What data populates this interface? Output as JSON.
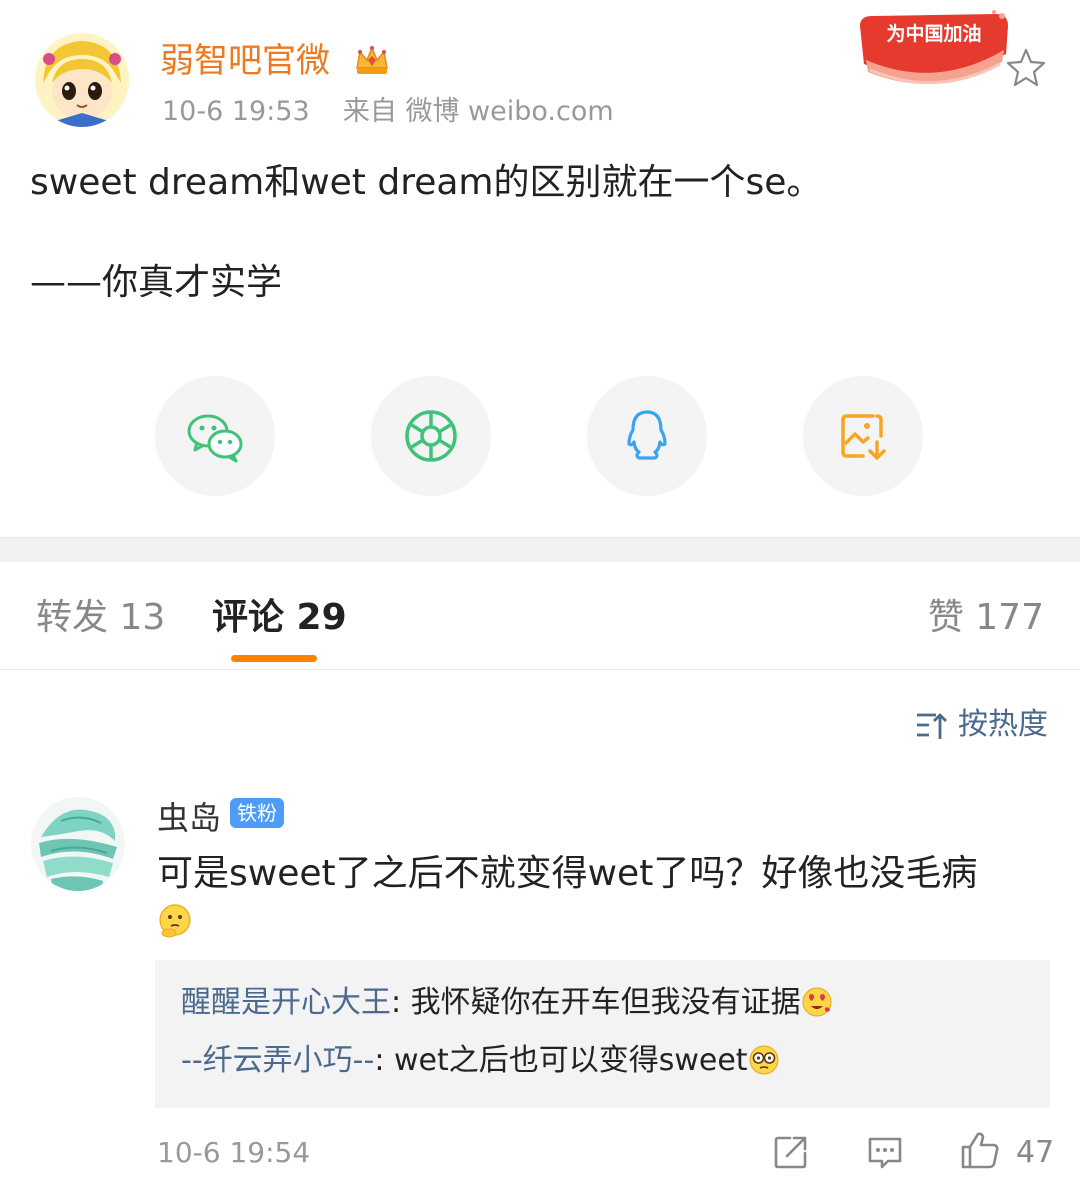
{
  "post": {
    "username": "弱智吧官微",
    "timestamp": "10-6 19:53",
    "source_prefix": "来自",
    "source": "微博 weibo.com",
    "promo_text": "为中国加油",
    "line1": "sweet dream和wet dream的区别就在一个se。",
    "line2": "——你真才实学"
  },
  "share": {
    "items": [
      "wechat-icon",
      "moments-icon",
      "qq-icon",
      "save-image-icon"
    ]
  },
  "tabs": {
    "repost": "转发 13",
    "comment": "评论 29",
    "like": "赞 177"
  },
  "sort": {
    "label": "按热度"
  },
  "comment": {
    "author": "虫岛",
    "badge": "铁粉",
    "text": "可是sweet了之后不就变得wet了吗？好像也没毛病",
    "replies": [
      {
        "name": "醒醒是开心大王",
        "text": ": 我怀疑你在开车但我没有证据"
      },
      {
        "name": "--纤云弄小巧--",
        "text": ": wet之后也可以变得sweet"
      }
    ],
    "time": "10-6 19:54",
    "like_count": "47"
  },
  "colors": {
    "username": "#ee7a1f",
    "accent": "#ff8200",
    "link": "#4a6a8f",
    "badge": "#4d9df7",
    "wechat": "#3fc27a",
    "qq": "#3aa4ee",
    "save": "#f5a623"
  }
}
